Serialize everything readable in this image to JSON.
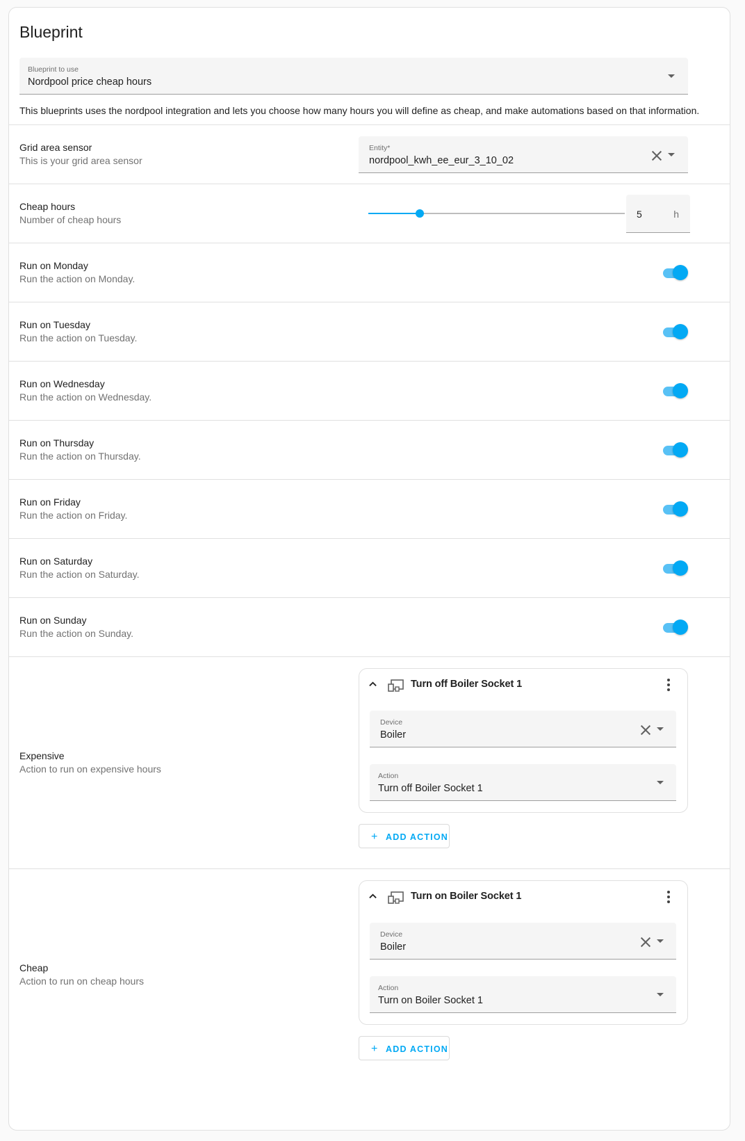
{
  "card": {
    "title": "Blueprint"
  },
  "blueprint_select": {
    "label": "Blueprint to use",
    "value": "Nordpool price cheap hours"
  },
  "blueprint_description": "This blueprints uses the nordpool integration and lets you choose how many hours you will define as cheap, and make automations based on that information.",
  "grid_area": {
    "title": "Grid area sensor",
    "subtitle": "This is your grid area sensor",
    "field_label": "Entity*",
    "field_value": "nordpool_kwh_ee_eur_3_10_02"
  },
  "cheap_hours": {
    "title": "Cheap hours",
    "subtitle": "Number of cheap hours",
    "value": "5",
    "unit": "h",
    "slider_fraction": 0.2
  },
  "days": [
    {
      "title": "Run on Monday",
      "subtitle": "Run the action on Monday.",
      "enabled": true
    },
    {
      "title": "Run on Tuesday",
      "subtitle": "Run the action on Tuesday.",
      "enabled": true
    },
    {
      "title": "Run on Wednesday",
      "subtitle": "Run the action on Wednesday.",
      "enabled": true
    },
    {
      "title": "Run on Thursday",
      "subtitle": "Run the action on Thursday.",
      "enabled": true
    },
    {
      "title": "Run on Friday",
      "subtitle": "Run the action on Friday.",
      "enabled": true
    },
    {
      "title": "Run on Saturday",
      "subtitle": "Run the action on Saturday.",
      "enabled": true
    },
    {
      "title": "Run on Sunday",
      "subtitle": "Run the action on Sunday.",
      "enabled": true
    }
  ],
  "expensive": {
    "title": "Expensive",
    "subtitle": "Action to run on expensive hours",
    "action_title": "Turn off Boiler Socket 1",
    "device_label": "Device",
    "device_value": "Boiler",
    "action_label": "Action",
    "action_value": "Turn off Boiler Socket 1",
    "add_label": "ADD ACTION"
  },
  "cheap": {
    "title": "Cheap",
    "subtitle": "Action to run on cheap hours",
    "action_title": "Turn on Boiler Socket 1",
    "device_label": "Device",
    "device_value": "Boiler",
    "action_label": "Action",
    "action_value": "Turn on Boiler Socket 1",
    "add_label": "ADD ACTION"
  },
  "colors": {
    "accent": "#03a9f4",
    "toggle_track": "#58c1f5",
    "field_bg": "#f5f5f5",
    "divider": "#e0e0e0"
  }
}
